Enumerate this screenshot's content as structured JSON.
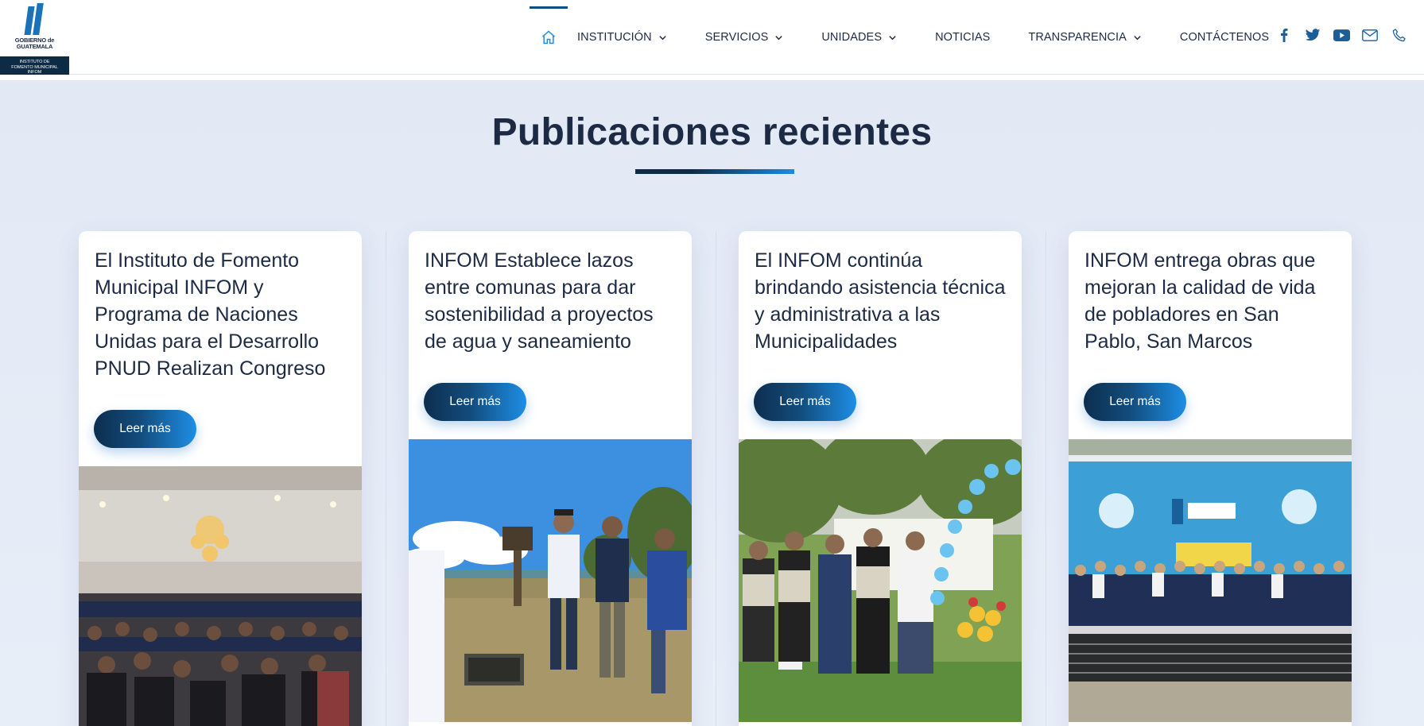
{
  "logo": {
    "line1": "GOBIERNO de",
    "line2": "GUATEMALA",
    "band1": "INSTITUTO DE",
    "band2": "FOMENTO MUNICIPAL",
    "band3": "INFOM"
  },
  "nav": {
    "items": [
      {
        "label": "INSTITUCIÓN",
        "dropdown": true
      },
      {
        "label": "SERVICIOS",
        "dropdown": true
      },
      {
        "label": "UNIDADES",
        "dropdown": true
      },
      {
        "label": "NOTICIAS",
        "dropdown": false
      },
      {
        "label": "TRANSPARENCIA",
        "dropdown": true
      },
      {
        "label": "CONTÁCTENOS",
        "dropdown": false
      }
    ],
    "socials": [
      "facebook-icon",
      "twitter-icon",
      "youtube-icon",
      "mail-icon",
      "phone-icon"
    ]
  },
  "section": {
    "title": "Publicaciones recientes"
  },
  "posts": [
    {
      "title": "El Instituto de Fomento Municipal INFOM y Programa de Naciones Unidas para el Desarrollo PNUD Realizan Congreso",
      "button": "Leer más",
      "image": "conference-hall-photo"
    },
    {
      "title": "INFOM Establece lazos entre comunas para dar sostenibilidad a proyectos de agua y saneamiento",
      "button": "Leer más",
      "image": "field-visit-photo"
    },
    {
      "title": "El INFOM continúa brindando asistencia técnica y administrativa a las Municipalidades",
      "button": "Leer más",
      "image": "ceremony-photo"
    },
    {
      "title": "INFOM entrega obras que mejoran la calidad de vida de pobladores en San Pablo, San Marcos",
      "button": "Leer más",
      "image": "water-plant-group-photo"
    }
  ],
  "colors": {
    "navy": "#0e2b45",
    "accent_blue": "#1d8ee6",
    "text": "#1d2a44",
    "background": "#e2e9f5"
  }
}
